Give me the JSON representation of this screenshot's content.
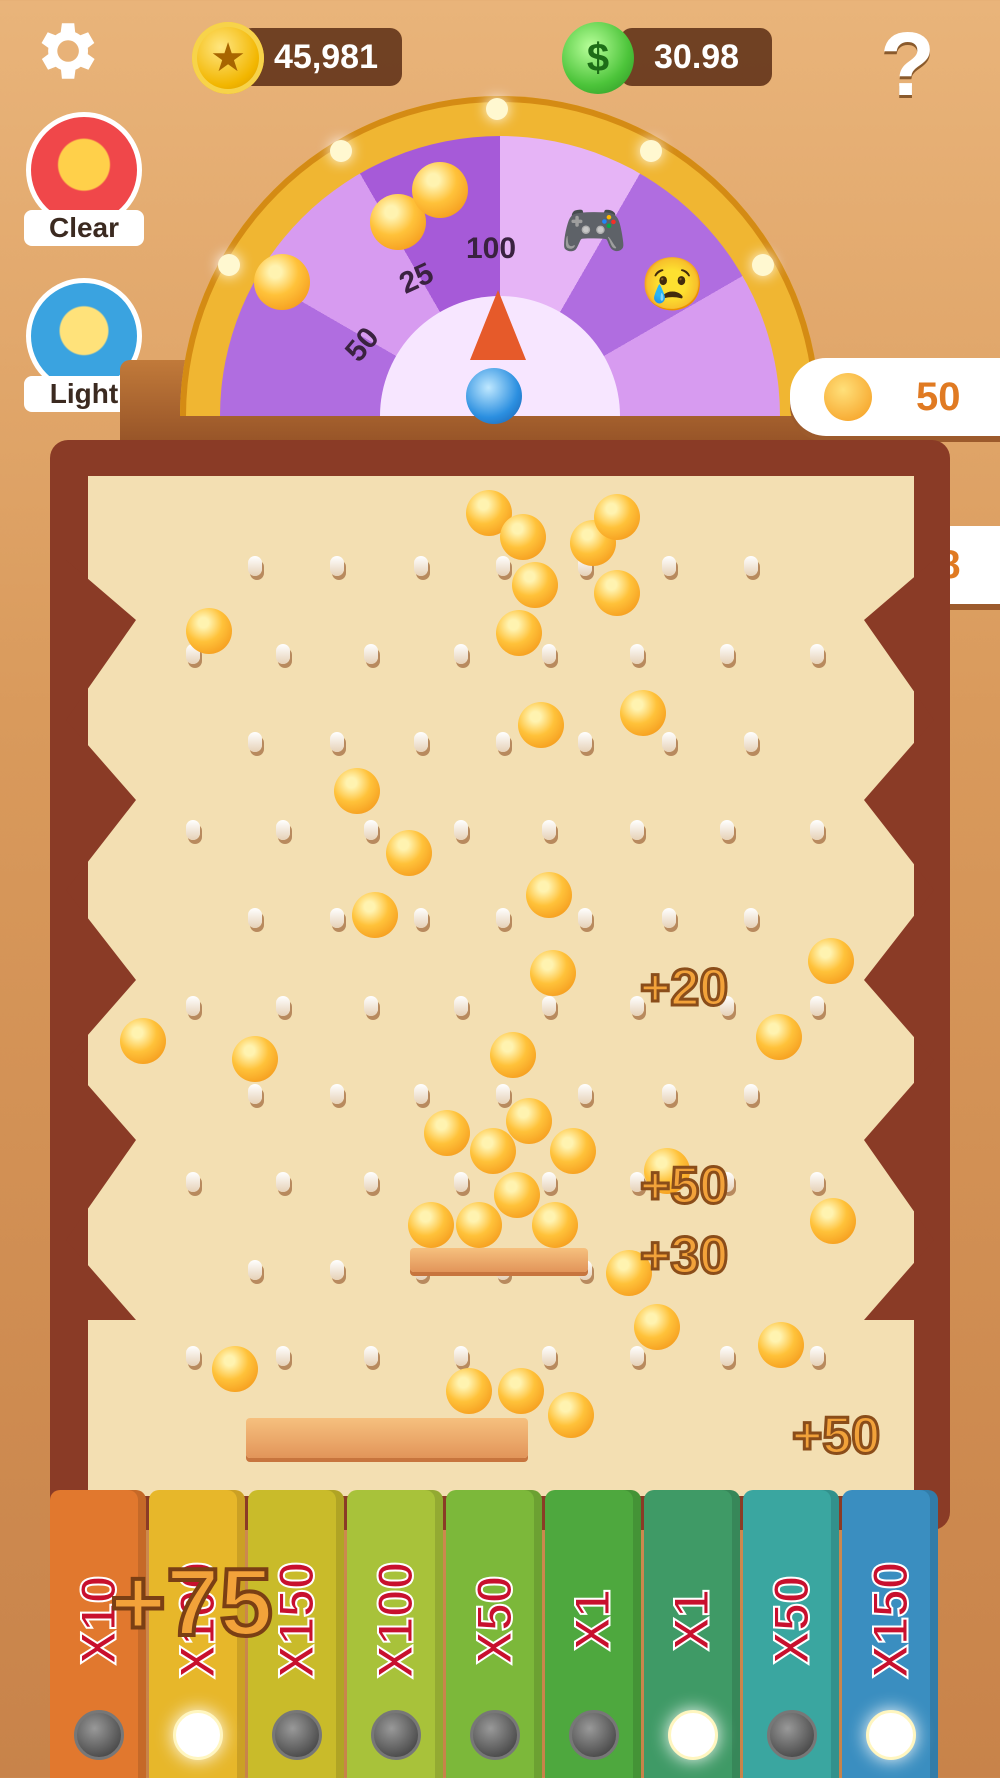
{
  "top_bar": {
    "coins": "45,981",
    "cash": "30.98",
    "cash_symbol": "$",
    "help": "?"
  },
  "side_buttons": {
    "clear": "Clear",
    "light": "Light"
  },
  "wheel": {
    "labels": [
      "25",
      "100",
      "50"
    ]
  },
  "side_rewards": [
    {
      "value": "50"
    },
    {
      "value": "58"
    }
  ],
  "floating_points": [
    "+20",
    "+50",
    "+30",
    "+50",
    "+75"
  ],
  "buckets": [
    {
      "multiplier": "X10",
      "color": "#e1782e",
      "lit": false
    },
    {
      "multiplier": "X100",
      "color": "#e7b72a",
      "lit": true
    },
    {
      "multiplier": "X150",
      "color": "#c9bb2a",
      "lit": false
    },
    {
      "multiplier": "X100",
      "color": "#a8c23a",
      "lit": false
    },
    {
      "multiplier": "X50",
      "color": "#7cb83a",
      "lit": false
    },
    {
      "multiplier": "X1",
      "color": "#4ea83e",
      "lit": false
    },
    {
      "multiplier": "X1",
      "color": "#3f9a66",
      "lit": true
    },
    {
      "multiplier": "X50",
      "color": "#3aa6a0",
      "lit": false
    },
    {
      "multiplier": "X150",
      "color": "#3a8ec0",
      "lit": true
    }
  ]
}
